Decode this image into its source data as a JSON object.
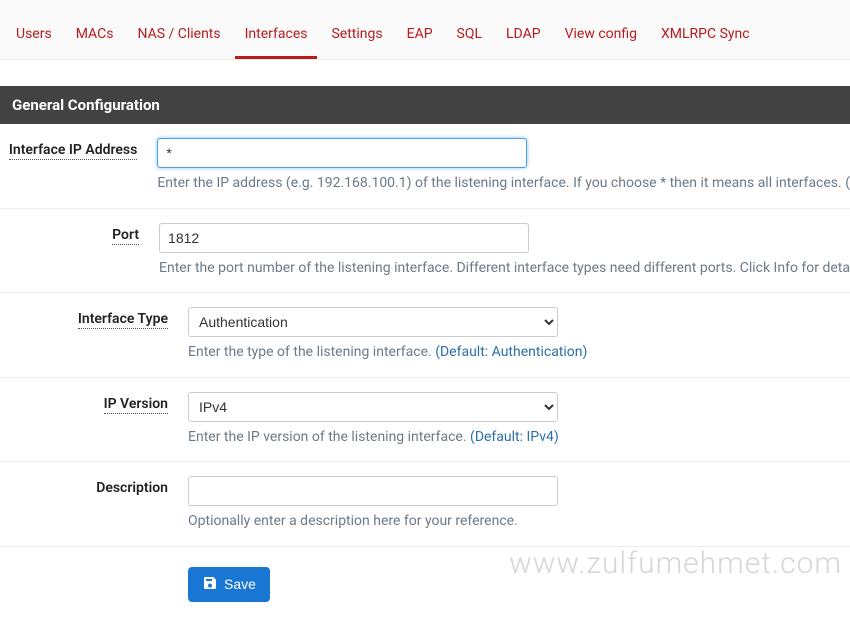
{
  "tabs": {
    "users": "Users",
    "macs": "MACs",
    "nas": "NAS / Clients",
    "interfaces": "Interfaces",
    "settings": "Settings",
    "eap": "EAP",
    "sql": "SQL",
    "ldap": "LDAP",
    "viewconfig": "View config",
    "xmlrpc": "XMLRPC Sync"
  },
  "section": {
    "title": "General Configuration"
  },
  "form": {
    "ip": {
      "label": "Interface IP Address",
      "value": "*",
      "help": "Enter the IP address (e.g. 192.168.100.1) of the listening interface. If you choose * then it means all interfaces. ("
    },
    "port": {
      "label": "Port",
      "value": "1812",
      "help": "Enter the port number of the listening interface. Different interface types need different ports. Click Info for deta"
    },
    "itype": {
      "label": "Interface Type",
      "value": "Authentication",
      "help_pre": "Enter the type of the listening interface. ",
      "help_def": "(Default: Authentication)"
    },
    "ipver": {
      "label": "IP Version",
      "value": "IPv4",
      "help_pre": "Enter the IP version of the listening interface. ",
      "help_def": "(Default: IPv4)"
    },
    "desc": {
      "label": "Description",
      "value": "",
      "help": "Optionally enter a description here for your reference."
    }
  },
  "buttons": {
    "save": "Save"
  },
  "watermark": "www.zulfumehmet.com"
}
